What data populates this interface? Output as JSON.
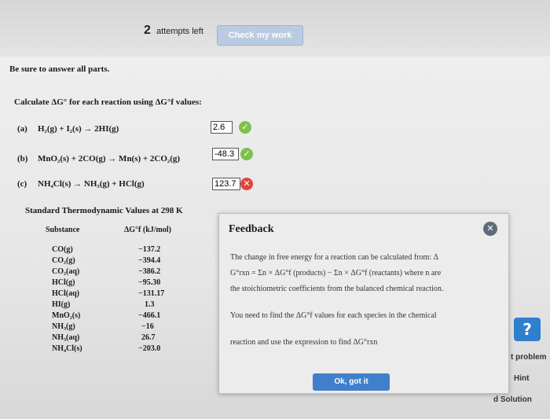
{
  "header": {
    "attempts_num": "2",
    "attempts_text": "attempts left",
    "check_label": "Check my work"
  },
  "instructions": "Be sure to answer all parts.",
  "question": "Calculate ΔG° for each reaction using ΔG°f values:",
  "parts": [
    {
      "label": "(a)",
      "reaction": "H₂(g) + I₂(s) → 2HI(g)",
      "answer": "2.6",
      "correct": true
    },
    {
      "label": "(b)",
      "reaction": "MnO₂(s) + 2CO(g) → Mn(s) + 2CO₂(g)",
      "answer": "-48.3",
      "correct": true
    },
    {
      "label": "(c)",
      "reaction": "NH₄Cl(s) → NH₃(g) + HCl(g)",
      "answer": "123.7",
      "correct": false
    }
  ],
  "table": {
    "title": "Standard Thermodynamic Values at 298 K",
    "col_substance": "Substance",
    "col_value": "ΔG°f (kJ/mol)",
    "rows": [
      {
        "substance": "CO(g)",
        "value": "−137.2"
      },
      {
        "substance": "CO₂(g)",
        "value": "−394.4"
      },
      {
        "substance": "CO₂(aq)",
        "value": "−386.2"
      },
      {
        "substance": "HCl(g)",
        "value": "−95.30"
      },
      {
        "substance": "HCl(aq)",
        "value": "−131.17"
      },
      {
        "substance": "HI(g)",
        "value": "1.3"
      },
      {
        "substance": "MnO₂(s)",
        "value": "−466.1"
      },
      {
        "substance": "NH₃(g)",
        "value": "−16"
      },
      {
        "substance": "NH₃(aq)",
        "value": "26.7"
      },
      {
        "substance": "NH₄Cl(s)",
        "value": "−203.0"
      }
    ]
  },
  "feedback": {
    "title": "Feedback",
    "lines": [
      "The change in free energy for a reaction can be calculated from: Δ",
      "G°rxn = Σn × ΔG°f (products) − Σn × ΔG°f (reactants) where n are",
      "the stoichiometric coefficients from the balanced chemical reaction.",
      "You need to find the ΔG°f values for each species in the chemical",
      "reaction and use the expression to find ΔG°rxn"
    ],
    "ok_label": "Ok, got it",
    "close_glyph": "✕"
  },
  "side": {
    "help_glyph": "?",
    "problem": "t problem",
    "hint": "Hint",
    "solution": "d Solution"
  }
}
